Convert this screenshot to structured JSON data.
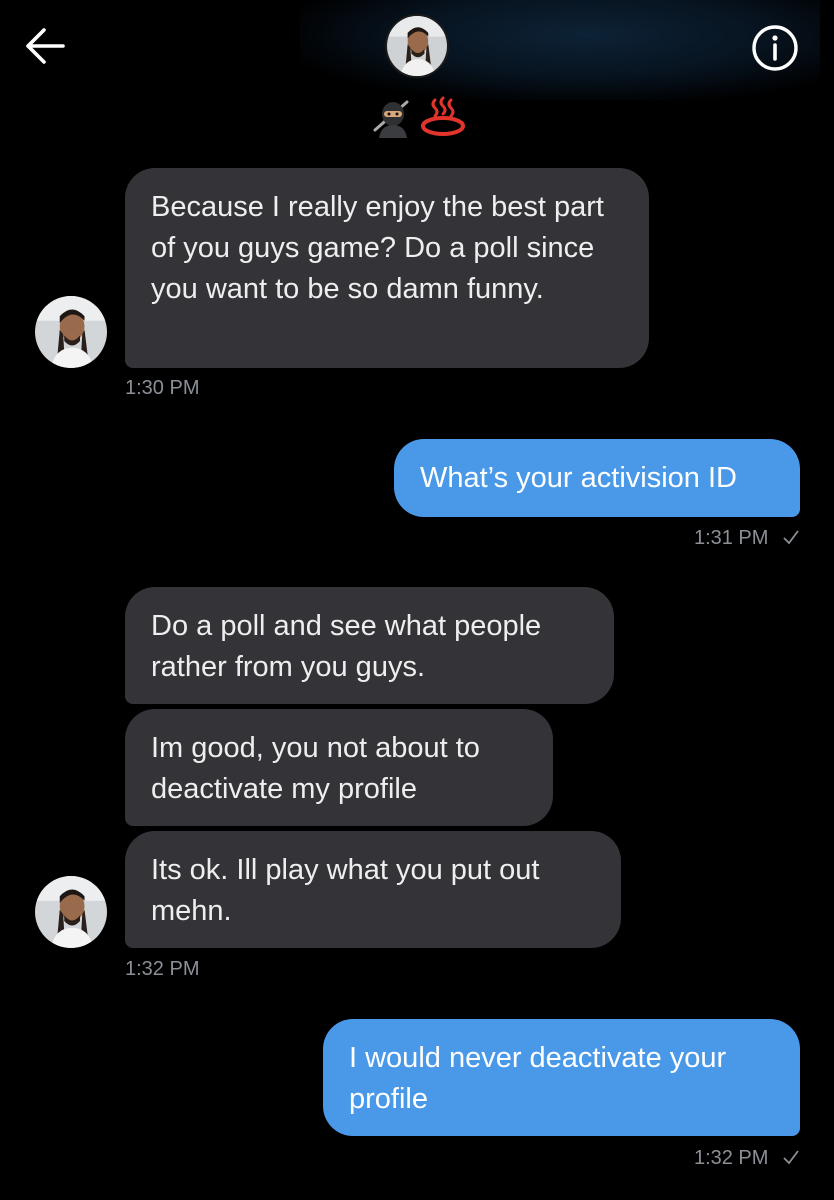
{
  "header": {
    "back_icon": "back-arrow-icon",
    "info_icon": "info-icon",
    "status_emoji": [
      "ninja-emoji",
      "hot-springs-emoji"
    ]
  },
  "colors": {
    "background": "#000000",
    "incoming_bubble": "#343438",
    "outgoing_bubble": "#4a99e9",
    "timestamp": "#8b9096"
  },
  "messages": [
    {
      "direction": "incoming",
      "text": "Because I really enjoy the best part of you guys game? Do a poll since you want to be so damn funny.",
      "time": "1:30 PM"
    },
    {
      "direction": "outgoing",
      "text": "What’s your activision ID",
      "time": "1:31 PM",
      "read_icon": "checkmark-icon"
    },
    {
      "direction": "incoming",
      "text": "Do a poll and see what people rather from you guys."
    },
    {
      "direction": "incoming",
      "text": "Im good, you not about to deactivate my profile"
    },
    {
      "direction": "incoming",
      "text": "Its ok. Ill play what you put out mehn.",
      "time": "1:32 PM"
    },
    {
      "direction": "outgoing",
      "text": "I would never deactivate your profile",
      "time": "1:32 PM",
      "read_icon": "checkmark-icon"
    }
  ]
}
